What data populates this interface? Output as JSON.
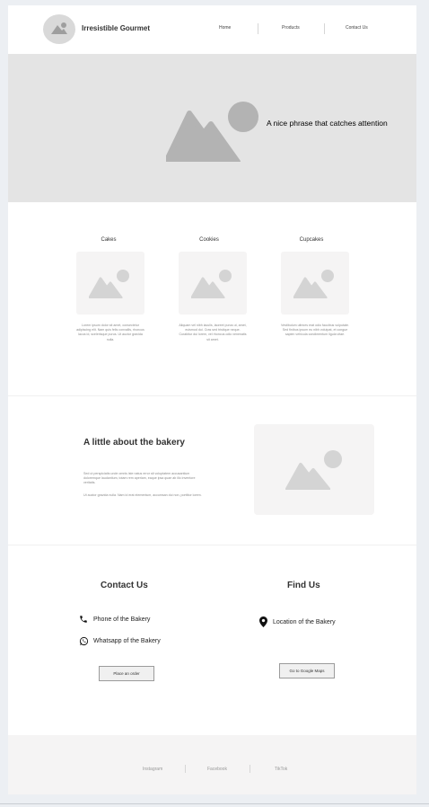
{
  "header": {
    "brand": "Irresistible Gourmet",
    "nav": [
      "Home",
      "Products",
      "Contact Us"
    ]
  },
  "hero": {
    "phrase": "A nice phrase that catches attention"
  },
  "products": [
    {
      "title": "Cakes",
      "desc": "Lorem ipsum dolor sit amet, consectetur adipiscing elit. Nam quis felis convallis, rhoncus lacus id, scelerisque purus. Ut auctor gravida nulla."
    },
    {
      "title": "Cookies",
      "desc": "Aliquam vel nibh iaculis, laoreet purus ut, amet, euismod dui. Cras sed tristique neque. Curabitur dui lorem, vel rhoncus odio venenatis sit amet."
    },
    {
      "title": "Cupcakes",
      "desc": "Vestibulum ultrices erat odio faucibus vulputate. Sed finibus ipsum eu nibh volutpat, et congue sapien vehicula condimentum ligula vitae."
    }
  ],
  "about": {
    "title": "A little about the bakery",
    "p1": "Sed ut perspiciatis unde omnis iste natus error sit voluptatem accusantium doloremque laudantium, totam rem aperiam, eaque ipsa quae ab illo inventore veritatis.",
    "p2": "Ut auctor gravida nulla. Nam id erat elementum, accumsan dui non, porttitor lorem."
  },
  "contact": {
    "title": "Contact Us",
    "phone": "Phone of the Bakery",
    "whatsapp": "Whatsapp of the Bakery",
    "button": "Place an order"
  },
  "find": {
    "title": "Find Us",
    "location": "Location of the Bakery",
    "button": "Go to Google Maps"
  },
  "footer": {
    "links": [
      "Instagram",
      "Facebook",
      "TikTok"
    ]
  },
  "icons": {
    "placeholder": "image-placeholder-icon",
    "phone": "phone-icon",
    "whatsapp": "whatsapp-icon",
    "location": "location-pin-icon"
  },
  "colors": {
    "page_bg": "#eceff3",
    "hero_bg": "#e4e4e4",
    "card_bg": "#f5f4f4",
    "placeholder_dark": "#b9b9b9",
    "placeholder_light": "#d9d9d9"
  }
}
